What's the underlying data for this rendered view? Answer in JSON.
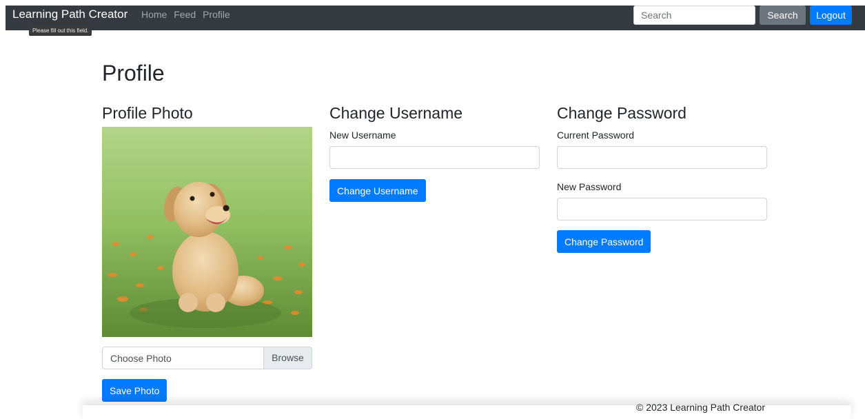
{
  "navbar": {
    "brand": "Learning Path Creator",
    "links": [
      "Home",
      "Feed",
      "Profile"
    ],
    "search_placeholder": "Search",
    "search_button": "Search",
    "logout_button": "Logout"
  },
  "tooltip": "Please fill out this field.",
  "page_title": "Profile",
  "photo_section": {
    "title": "Profile Photo",
    "image": "golden-retriever-puppy-photo",
    "file_label": "Choose Photo",
    "browse_label": "Browse",
    "save_button": "Save Photo"
  },
  "username_section": {
    "title": "Change Username",
    "new_username_label": "New Username",
    "new_username_value": "",
    "submit_button": "Change Username"
  },
  "password_section": {
    "title": "Change Password",
    "current_password_label": "Current Password",
    "current_password_value": "",
    "new_password_label": "New Password",
    "new_password_value": "",
    "submit_button": "Change Password"
  },
  "footer": "© 2023 Learning Path Creator",
  "colors": {
    "navbar_bg": "#343a40",
    "primary": "#007bff",
    "secondary": "#6c757d"
  }
}
